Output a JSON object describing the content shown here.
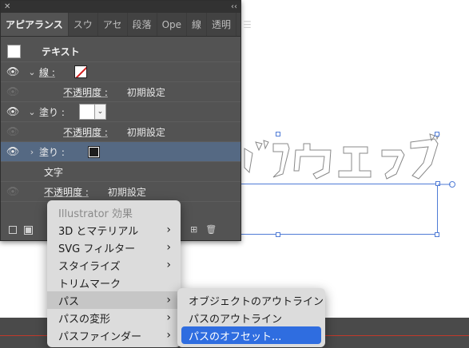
{
  "panel": {
    "tabs": [
      {
        "label": "アピアランス",
        "active": true
      },
      {
        "label": "スウ"
      },
      {
        "label": "アセ"
      },
      {
        "label": "段落"
      },
      {
        "label": "Ope"
      },
      {
        "label": "線"
      },
      {
        "label": "透明"
      }
    ],
    "header": "テキスト",
    "rows": {
      "stroke_label": "線 :",
      "stroke_opacity_label": "不透明度 :",
      "stroke_opacity_value": "初期設定",
      "fill1_label": "塗り :",
      "fill1_opacity_label": "不透明度 :",
      "fill1_opacity_value": "初期設定",
      "fill2_label": "塗り :",
      "characters_label": "文字",
      "opacity_label": "不透明度 :",
      "opacity_value": "初期設定"
    },
    "icons": {
      "close": "close-icon",
      "collapse": "collapse-icon",
      "menu": "panel-menu-icon",
      "eye": "eye-icon"
    }
  },
  "context_menu": {
    "items": [
      {
        "label": "Illustrator 効果",
        "disabled": true
      },
      {
        "label": "3D とマテリアル",
        "submenu": true
      },
      {
        "label": "SVG フィルター",
        "submenu": true
      },
      {
        "label": "スタイライズ",
        "submenu": true
      },
      {
        "label": "トリムマーク"
      },
      {
        "label": "パス",
        "submenu": true,
        "hover": true
      },
      {
        "label": "パスの変形",
        "submenu": true
      },
      {
        "label": "パスファインダー",
        "submenu": true
      }
    ]
  },
  "submenu": {
    "items": [
      {
        "label": "オブジェクトのアウトライン"
      },
      {
        "label": "パスのアウトライン"
      },
      {
        "label": "パスのオフセット...",
        "active": true
      }
    ]
  },
  "colors": {
    "panel_bg": "#535353",
    "selection_row": "#556983",
    "menu_active": "#2f6de0",
    "selection_bounds": "#4f7bd6"
  }
}
